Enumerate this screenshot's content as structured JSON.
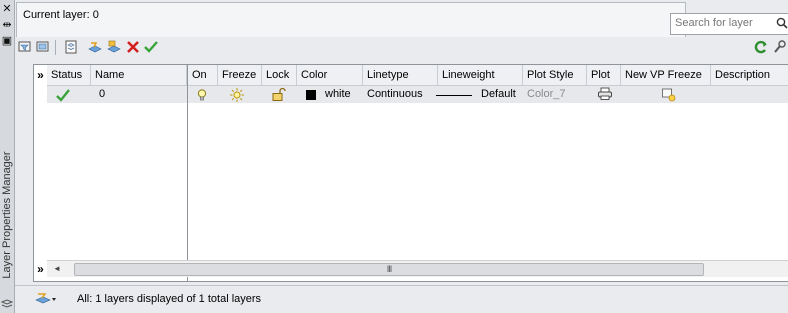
{
  "palette": {
    "title": "Layer Properties Manager",
    "close_glyph": "✕",
    "autohide_glyph": "⇹",
    "properties_glyph": "▣"
  },
  "header": {
    "current_layer": "Current layer: 0",
    "search_placeholder": "Search for layer"
  },
  "toolbar": {
    "icons": [
      "new-property-filter-icon",
      "new-group-filter-icon",
      "layer-states-manager-icon",
      "new-layer-icon",
      "new-layer-vp-frozen-icon",
      "delete-layer-icon",
      "set-current-icon",
      "refresh-icon",
      "settings-icon"
    ]
  },
  "filter_pane": {
    "collapse_glyph": "»",
    "expand_glyph": "»"
  },
  "grid": {
    "columns": [
      "Status",
      "Name",
      "On",
      "Freeze",
      "Lock",
      "Color",
      "Linetype",
      "Lineweight",
      "Plot Style",
      "Plot",
      "New VP Freeze",
      "Description"
    ],
    "rows": [
      {
        "status": "current",
        "name": "0",
        "on": "bulb-on",
        "freeze": "sun-thawed",
        "lock": "unlocked",
        "color_name": "white",
        "color_swatch": "#000000",
        "linetype": "Continuous",
        "lineweight": "Default",
        "plot_style": "Color_7",
        "plot": "printer",
        "new_vp_freeze": "thawed"
      }
    ],
    "scroll_grip": "III"
  },
  "status_bar": {
    "text": "All: 1 layers displayed of 1 total layers"
  },
  "colors": {
    "accent_green": "#3aa33a",
    "delete_red": "#d32020",
    "plot_style_gray": "#8a8a8a"
  }
}
